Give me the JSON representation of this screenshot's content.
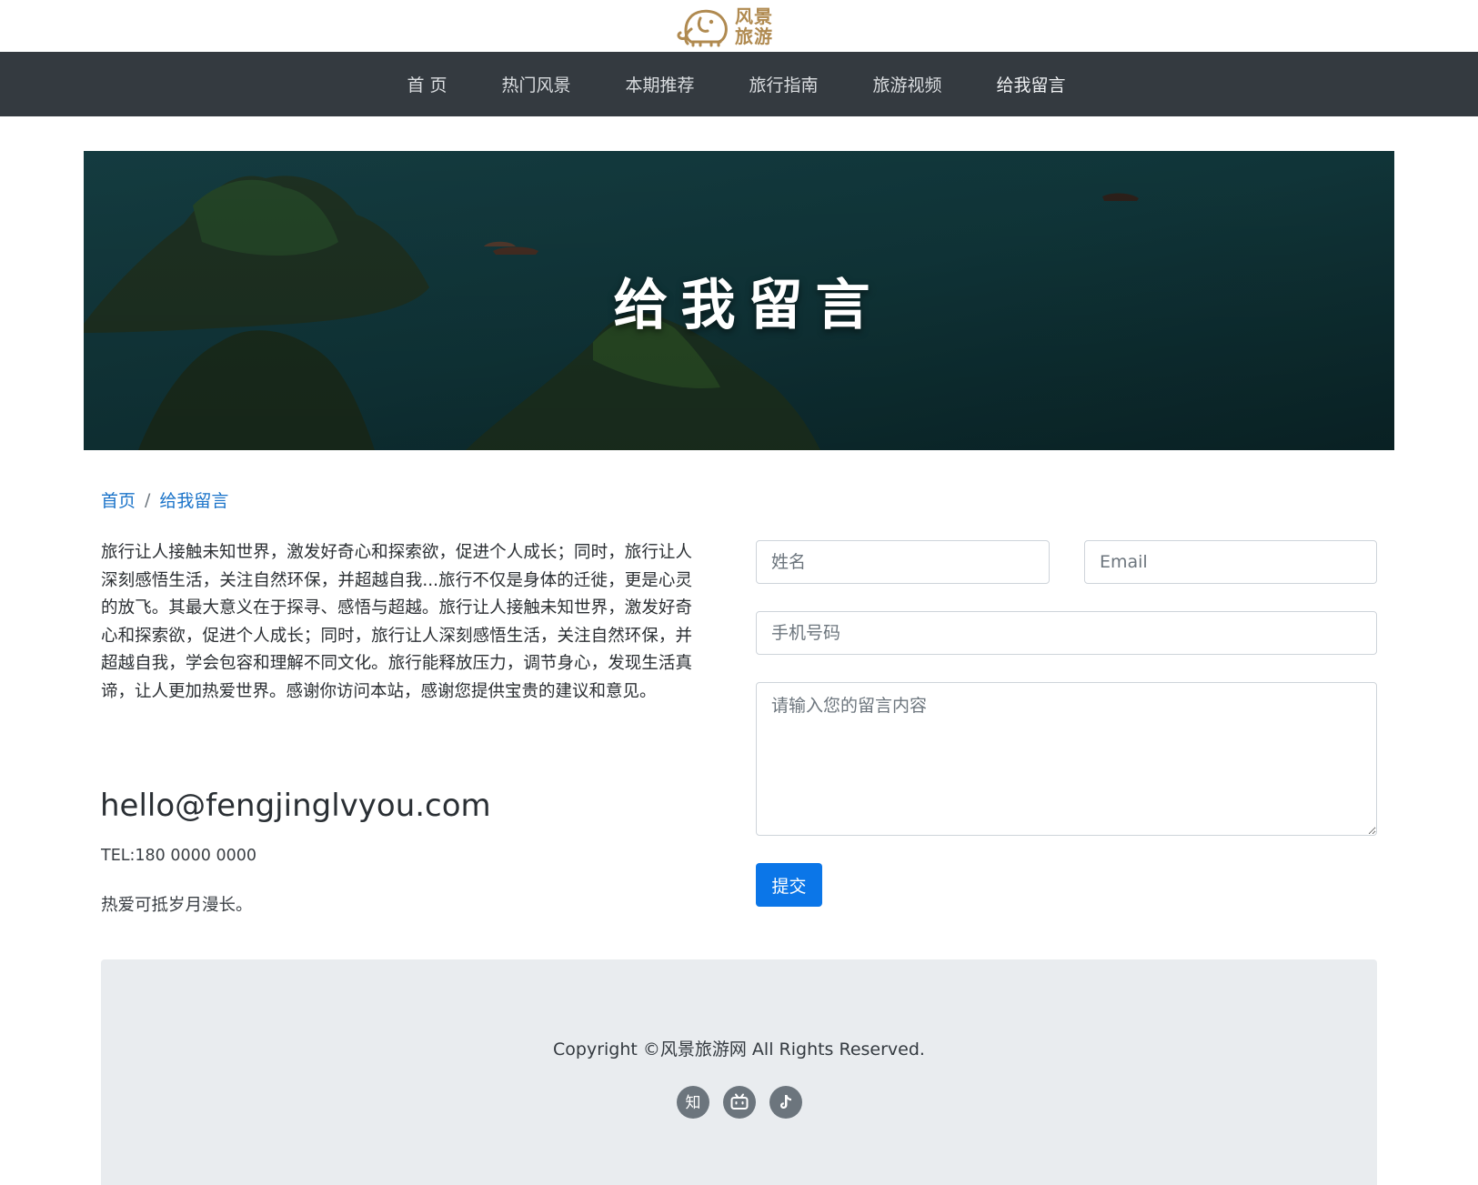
{
  "brand": {
    "line1": "风景",
    "line2": "旅游",
    "color": "#b08a50"
  },
  "nav": {
    "items": [
      {
        "label": "首 页"
      },
      {
        "label": "热门风景"
      },
      {
        "label": "本期推荐"
      },
      {
        "label": "旅行指南"
      },
      {
        "label": "旅游视频"
      },
      {
        "label": "给我留言"
      }
    ],
    "background": "#343a40"
  },
  "banner": {
    "title": "给我留言"
  },
  "breadcrumb": {
    "home": "首页",
    "separator": "/",
    "current": "给我留言"
  },
  "intro": {
    "text": "旅行让人接触未知世界，激发好奇心和探索欲，促进个人成长；同时，旅行让人深刻感悟生活，关注自然环保，并超越自我...旅行不仅是身体的迁徙，更是心灵的放飞。其最大意义在于探寻、感悟与超越。旅行让人接触未知世界，激发好奇心和探索欲，促进个人成长；同时，旅行让人深刻感悟生活，关注自然环保，并超越自我，学会包容和理解不同文化。旅行能释放压力，调节身心，发现生活真谛，让人更加热爱世界。感谢你访问本站，感谢您提供宝贵的建议和意见。"
  },
  "contact": {
    "email": "hello@fengjinglvyou.com",
    "tel": "TEL:180 0000 0000",
    "motto": "热爱可抵岁月漫长。"
  },
  "form": {
    "name_placeholder": "姓名",
    "email_placeholder": "Email",
    "phone_placeholder": "手机号码",
    "message_placeholder": "请输入您的留言内容",
    "submit_label": "提交",
    "submit_color": "#0b76e8"
  },
  "footer": {
    "copyright": "Copyright ©风景旅游网 All Rights Reserved.",
    "socials": [
      {
        "icon": "zhihu-icon",
        "glyph": "知"
      },
      {
        "icon": "bilibili-icon"
      },
      {
        "icon": "tiktok-icon"
      }
    ]
  }
}
